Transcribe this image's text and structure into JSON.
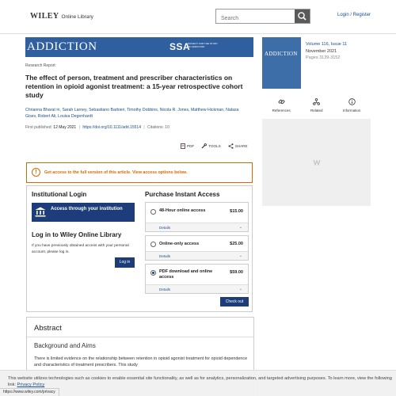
{
  "header": {
    "logo_brand": "WILEY",
    "logo_suffix": "Online Library",
    "search_placeholder": "Search",
    "login_label": "Login / Register"
  },
  "banner": {
    "journal": "ADDICTION",
    "ssa": "SSA",
    "ssa_sub": "Society for the Study of Addiction"
  },
  "article": {
    "type": "Research Report",
    "title": "The effect of person, treatment and prescriber characteristics on retention in opioid agonist treatment: a 15-year retrospective cohort study",
    "authors": "Chrianna Bharat ✉, Sarah Larney, Sebastiano Barbieri, Timothy Dobbins, Nicola R. Jones, Matthew Hickman, Natasa Gisev, Robert Ali, Louisa Degenhardt",
    "first_published_label": "First published:",
    "first_published": "12 May 2021",
    "doi": "https://doi.org/10.1111/add.15514",
    "citations": "Citations: 10"
  },
  "tools": {
    "pdf": "PDF",
    "tools": "TOOLS",
    "share": "SHARE"
  },
  "access": {
    "notice": "Get access to the full version of this article. View access options below."
  },
  "institutional": {
    "heading": "Institutional Login",
    "button": "Access through your institution"
  },
  "wol_login": {
    "heading": "Log in to Wiley Online Library",
    "text": "If you have previously obtained access with your personal account, please log in.",
    "button": "Log in"
  },
  "purchase": {
    "heading": "Purchase Instant Access",
    "options": [
      {
        "label": "48-Hour online access",
        "price": "$15.00",
        "details": "Details",
        "selected": false
      },
      {
        "label": "Online-only access",
        "price": "$25.00",
        "details": "Details",
        "selected": false
      },
      {
        "label": "PDF download and online access",
        "price": "$59.00",
        "details": "Details",
        "selected": true
      }
    ],
    "checkout": "Check out"
  },
  "abstract": {
    "heading": "Abstract",
    "subheading": "Background and Aims",
    "text": "There is limited evidence on the relationship between retention in opioid agonist treatment for opioid dependence and characteristics of treatment prescribers. This study"
  },
  "issue": {
    "volume_issue": "Volume 116, Issue 11",
    "date": "November 2021",
    "pages": "Pages 3139-3152",
    "cover_title": "ADDICTION"
  },
  "right_links": {
    "references": "References",
    "related": "Related",
    "information": "Information"
  },
  "cookie": {
    "text": "This website utilizes technologies such as cookies to enable essential site functionality, as well as for analytics, personalization, and targeted advertising purposes. To learn more, view the following link:",
    "link": "Privacy Policy"
  },
  "status_url": "https://www.wiley.com/privacy",
  "colors": {
    "brand_blue": "#1c3d7a",
    "link_blue": "#1a4e8a",
    "banner_blue": "#2f5f9e",
    "alert_orange": "#d36b00"
  }
}
